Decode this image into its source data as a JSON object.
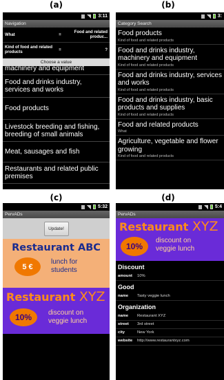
{
  "labels": {
    "a": "(a)",
    "b": "(b)",
    "c": "(c)",
    "d": "(d)"
  },
  "status": {
    "time_full": "3:11",
    "time_cut": "3:",
    "time_c": "5:32",
    "time_d": "5:4"
  },
  "a": {
    "title": "Navigation",
    "rows": [
      {
        "key": "What",
        "eq": "=",
        "value": "Food and related produc..."
      },
      {
        "key": "Kind of food and related products",
        "eq": "=",
        "value": "?"
      }
    ],
    "choose_label": "Choose a value",
    "items": [
      "machinery and equipment",
      "Food and drinks industry, services and works",
      "Food products",
      "Livestock breeding and fishing, breeding of small animals",
      "Meat, sausages and fish",
      "Restaurants and related public premises"
    ]
  },
  "b": {
    "title": "Category Search",
    "items": [
      {
        "title": "Food products",
        "subtitle": "Kind of food and related products"
      },
      {
        "title": "Food and drinks industry, machinery and equipment",
        "subtitle": "Kind of food and related products"
      },
      {
        "title": "Food and drinks industry, services and works",
        "subtitle": "Kind of food and related products"
      },
      {
        "title": "Food and drinks industry, basic products and supplies",
        "subtitle": "Kind of food and related products"
      },
      {
        "title": "Food and related products",
        "subtitle": "What"
      },
      {
        "title": "Agriculture, vegetable and flower growing",
        "subtitle": "Kind of food and related products"
      }
    ]
  },
  "c": {
    "title": "PervADs",
    "update_label": "Update!",
    "ad1": {
      "heading": "Restaurant ABC",
      "badge": "5 €",
      "text_line1": "lunch for",
      "text_line2": "students"
    },
    "ad2": {
      "heading": "Restaurant",
      "heading_suffix": "XYZ",
      "badge": "10%",
      "text_line1": "discount on",
      "text_line2": "veggie lunch"
    }
  },
  "d": {
    "title": "PervADs",
    "ad": {
      "heading": "Restaurant",
      "heading_suffix": "XYZ",
      "badge": "10%",
      "text_line1": "discount on",
      "text_line2": "veggie lunch"
    },
    "sections": [
      {
        "title": "Discount",
        "rows": [
          {
            "key": "amount",
            "value": "10%"
          }
        ]
      },
      {
        "title": "Good",
        "rows": [
          {
            "key": "name",
            "value": "Tasty veggie lunch"
          }
        ]
      },
      {
        "title": "Organization",
        "rows": [
          {
            "key": "name",
            "value": "Restaurant XYZ"
          },
          {
            "key": "street",
            "value": "3rd street"
          },
          {
            "key": "city",
            "value": "New York"
          },
          {
            "key": "website",
            "value": "http://www.restaurantxyz.com"
          }
        ]
      }
    ]
  },
  "colors": {
    "ad1_bg": "#f4b078",
    "ad2_bg": "#6a2bd8",
    "badge": "#f07800",
    "ad1_text": "#1a2b8f",
    "ad2_heading": "#ff8c1a"
  }
}
